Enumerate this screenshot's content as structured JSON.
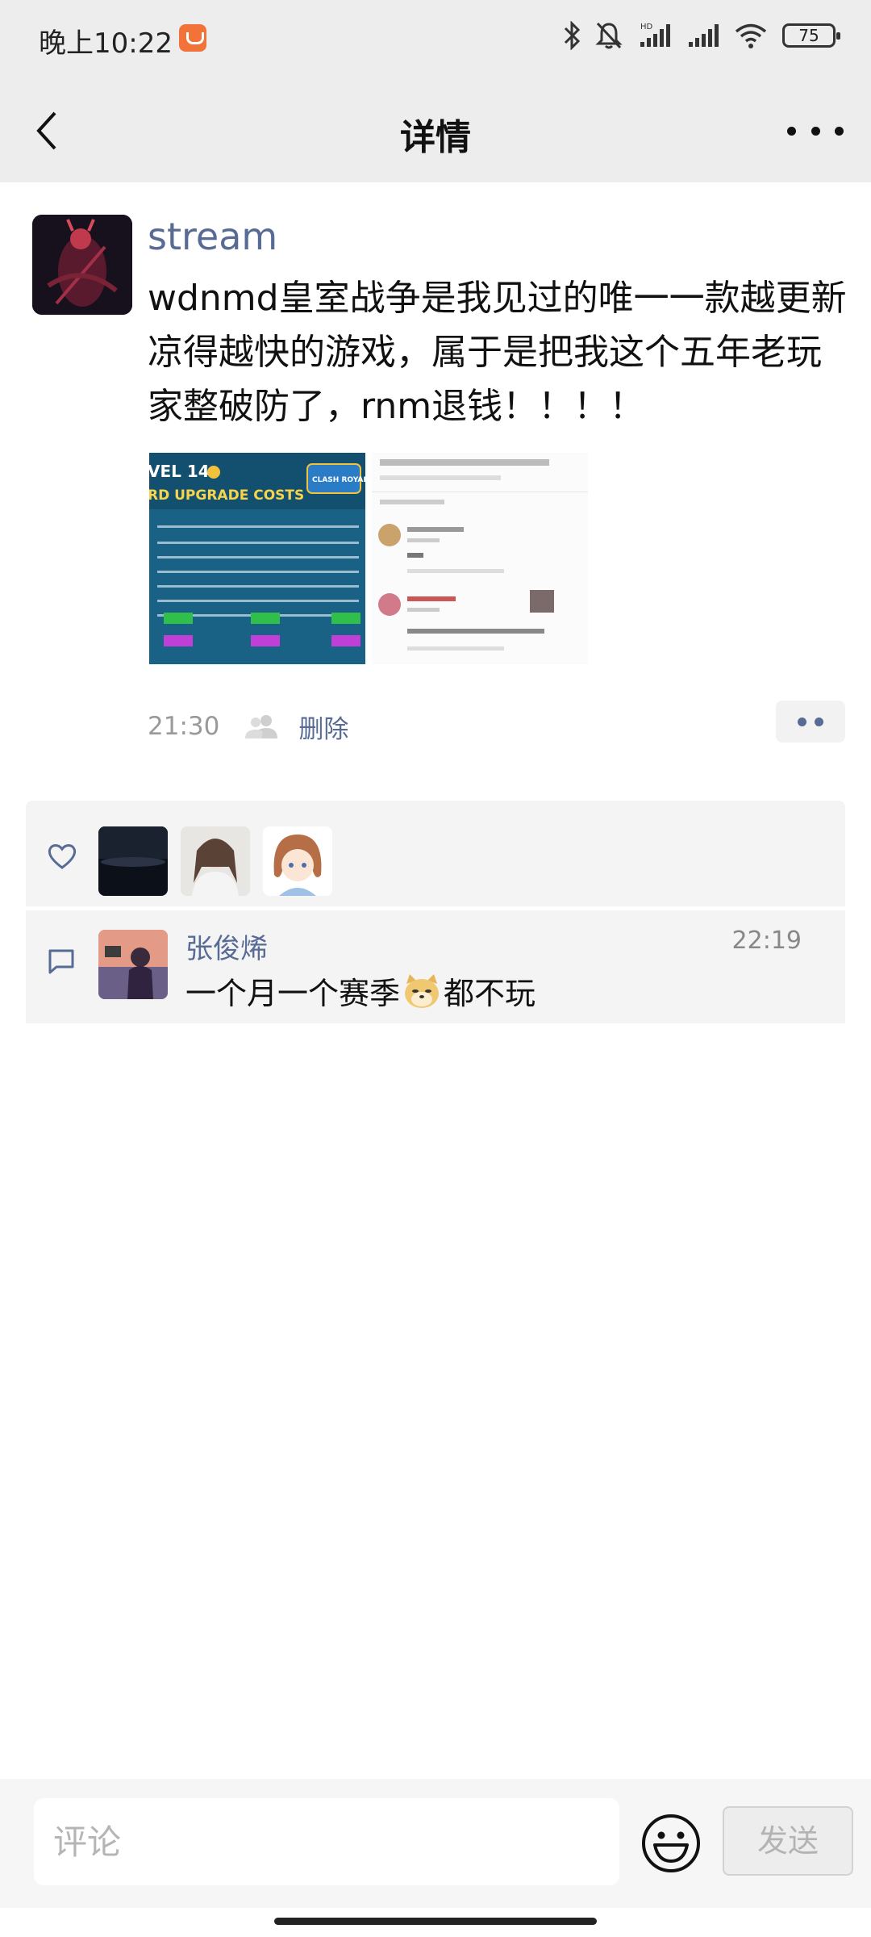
{
  "status_bar": {
    "time": "晚上10:22",
    "battery": "75",
    "network_badge": "HD"
  },
  "header": {
    "title": "详情",
    "back_icon": "chevron-left-icon",
    "more_icon": "more-dots-icon"
  },
  "post": {
    "username": "stream",
    "text": "wdnmd皇室战争是我见过的唯一一款越更新凉得越快的游戏，属于是把我这个五年老玩家整破防了，rnm退钱！！！！",
    "time": "21:30",
    "delete_label": "删除",
    "images": [
      {
        "name": "card-upgrade-costs-image",
        "caption": "VEL 14",
        "subcaption": "RD UPGRADE COSTS",
        "logo": "CLASH ROYALE"
      },
      {
        "name": "comment-screenshot-image"
      }
    ]
  },
  "likes": {
    "count": 3
  },
  "comments": [
    {
      "name": "张俊烯",
      "time": "22:19",
      "text_before": "一个月一个赛季",
      "emoji": "doge",
      "text_after": "都不玩"
    }
  ],
  "input": {
    "placeholder": "评论",
    "send_label": "发送"
  }
}
